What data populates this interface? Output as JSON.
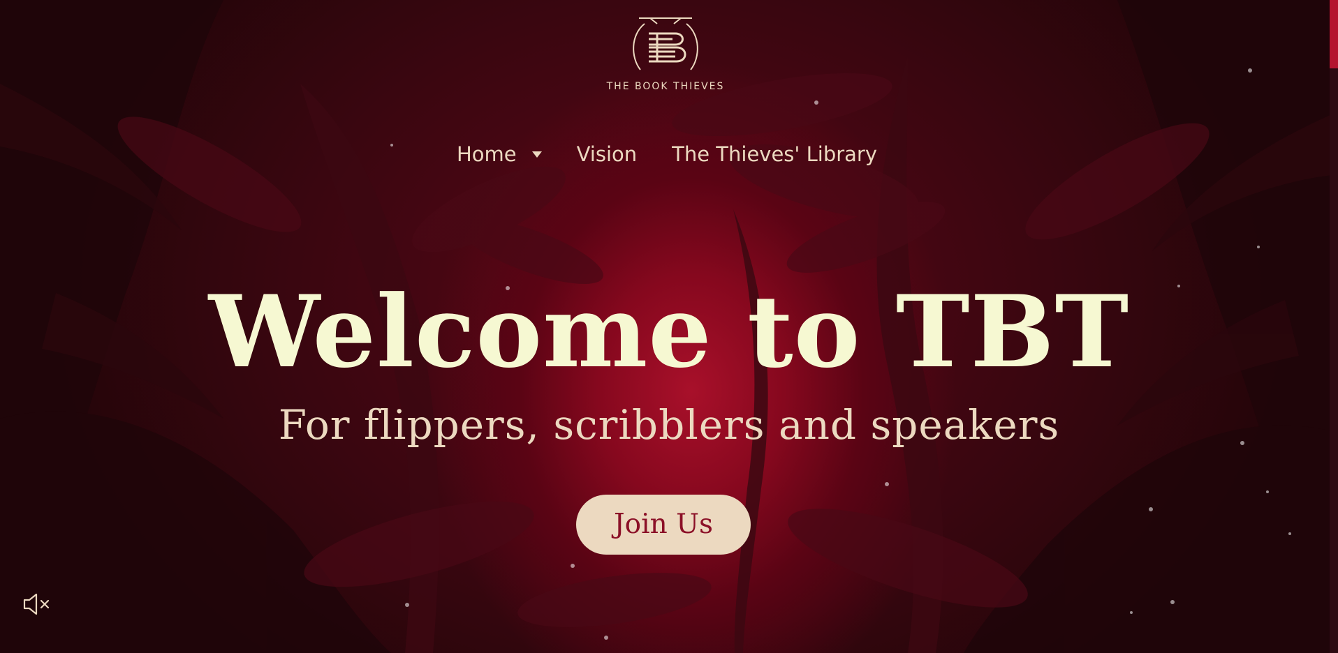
{
  "brand": {
    "name": "THE BOOK THIEVES",
    "logo_letter": "B",
    "logo_icon": "book-stack-emblem-icon"
  },
  "nav": {
    "items": [
      {
        "label": "Home",
        "has_dropdown": true,
        "dropdown_icon": "caret-down-icon"
      },
      {
        "label": "Vision"
      },
      {
        "label": "The Thieves' Library"
      }
    ]
  },
  "hero": {
    "title": "Welcome to TBT",
    "subtitle": "For flippers, scribblers and speakers",
    "cta_label": "Join Us"
  },
  "audio": {
    "icon": "speaker-muted-icon",
    "muted": true
  },
  "colors": {
    "accent_cream": "#ecd9c0",
    "title_cream": "#f6f8d2",
    "button_text": "#8b1027",
    "background_dark": "#2a0710",
    "glow_red": "#a8102a",
    "scrollbar": "#b4142f"
  }
}
